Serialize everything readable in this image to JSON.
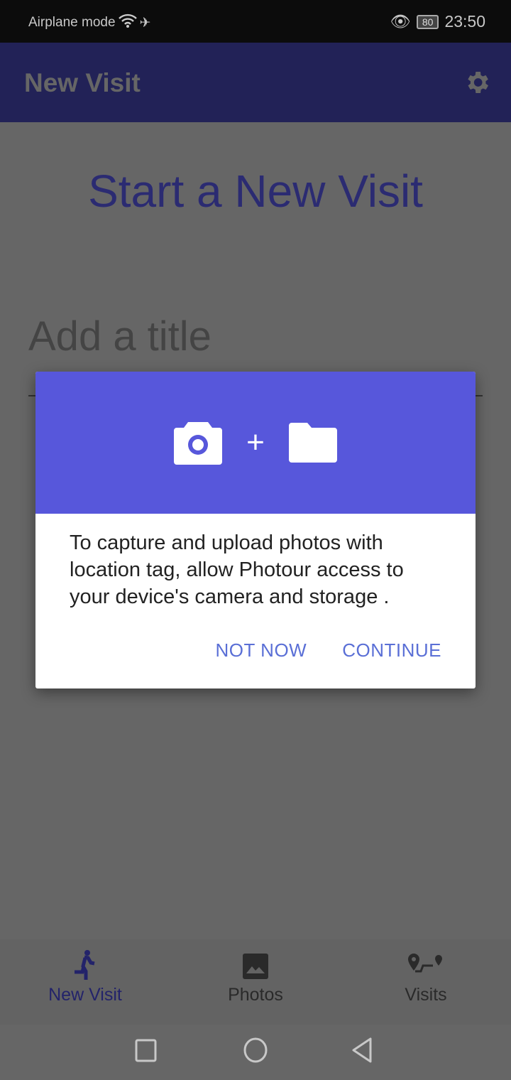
{
  "status_bar": {
    "network": "Airplane mode",
    "battery": "80",
    "time": "23:50"
  },
  "app_bar": {
    "title": "New Visit",
    "settings_icon": "gear-icon"
  },
  "main": {
    "headline": "Start a New Visit",
    "title_placeholder": "Add a title"
  },
  "dialog": {
    "icons": [
      "camera-icon",
      "plus",
      "folder-icon"
    ],
    "plus": "+",
    "message": "To capture and upload photos with location tag, allow Photour access to your device's camera and storage .",
    "not_now": "NOT NOW",
    "continue": "CONTINUE",
    "accent": "#5757db"
  },
  "bottom_nav": {
    "items": [
      {
        "label": "New Visit",
        "active": true
      },
      {
        "label": "Photos"
      },
      {
        "label": "Visits"
      }
    ]
  }
}
